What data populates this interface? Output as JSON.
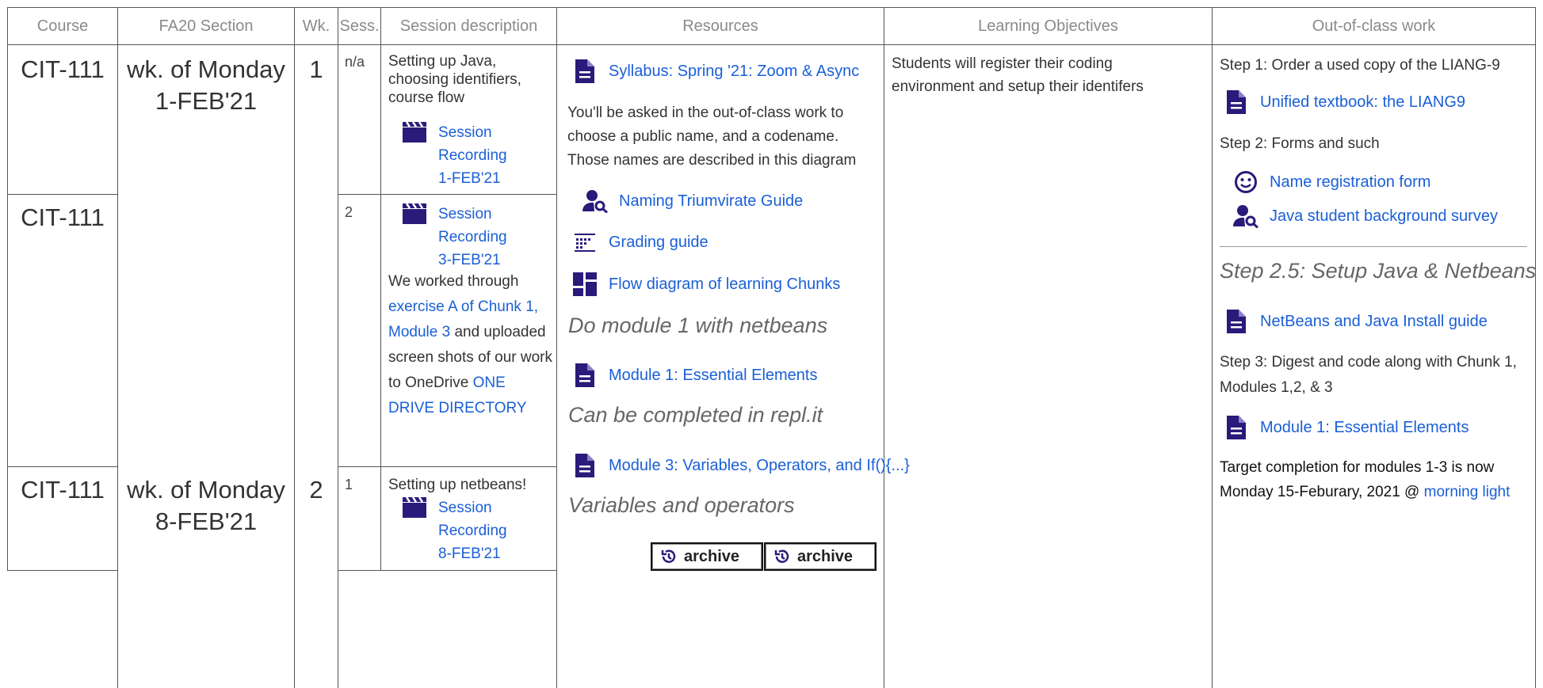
{
  "headers": {
    "course": "Course",
    "section": "FA20 Section",
    "week": "Wk.",
    "session": "Sess.",
    "description": "Session description",
    "resources": "Resources",
    "objectives": "Learning Objectives",
    "work": "Out-of-class work"
  },
  "rows": [
    {
      "course": "CIT-111",
      "section": "wk. of Monday 1-FEB'21",
      "week": "1",
      "session": "n/a",
      "description": "Setting up Java, choosing identifiers, course flow",
      "recording": "Session Recording 1-FEB'21"
    },
    {
      "course": "CIT-111",
      "session": "2",
      "recording": "Session Recording 3-FEB'21",
      "desc_pre": "We worked through",
      "desc_link": "exercise A of Chunk 1, Module 3",
      "desc_mid": "and uploaded screen shots of our work to OneDrive",
      "desc_link2": "ONE DRIVE DIRECTORY"
    },
    {
      "course": "CIT-111",
      "section": "wk. of Monday 8-FEB'21",
      "week": "2",
      "session": "1",
      "description": "Setting up netbeans!",
      "recording": "Session Recording 8-FEB'21"
    }
  ],
  "resources": {
    "syllabus": "Syllabus: Spring '21: Zoom & Async",
    "names_note": "You'll be asked in the out-of-class work to choose a public name, and a codename. Those names are described in this diagram",
    "naming_guide": "Naming Triumvirate Guide",
    "grading": "Grading guide",
    "flow": "Flow diagram of learning Chunks",
    "h_module1": "Do module 1 with netbeans",
    "module1": "Module 1: Essential Elements",
    "h_replit": "Can be completed in repl.it",
    "module3": "Module 3: Variables, Operators, and If(){...}",
    "h_vars": "Variables and operators",
    "archive1": "archive",
    "archive2": "archive"
  },
  "objectives": {
    "text": "Students will register their coding environment and setup their identifers"
  },
  "work": {
    "step1": "Step 1: Order a used copy of the LIANG-9",
    "textbook": "Unified textbook: the LIANG9",
    "step2": "Step 2: Forms and such",
    "name_form": "Name registration form",
    "survey": "Java student background survey",
    "step25": "Step 2.5: Setup Java & Netbeans",
    "install": "NetBeans and Java Install guide",
    "step3": "Step 3: Digest and code along with Chunk 1, Modules 1,2, & 3",
    "module1": "Module 1: Essential Elements",
    "target_pre": "Target completion for modules 1-3 is now Monday 15-Feburary, 2021 @",
    "target_link": "morning light"
  },
  "colors": {
    "link": "#1a5fd6",
    "icon": "#2a1a7a",
    "border": "#555555",
    "header_text": "#8a8a8a"
  },
  "icons": {
    "doc": "document-icon",
    "clapper": "clapperboard-icon",
    "person_search": "person-search-icon",
    "grid": "grading-grid-icon",
    "dashboard": "dashboard-icon",
    "smiley": "smiley-icon",
    "history": "history-icon"
  }
}
